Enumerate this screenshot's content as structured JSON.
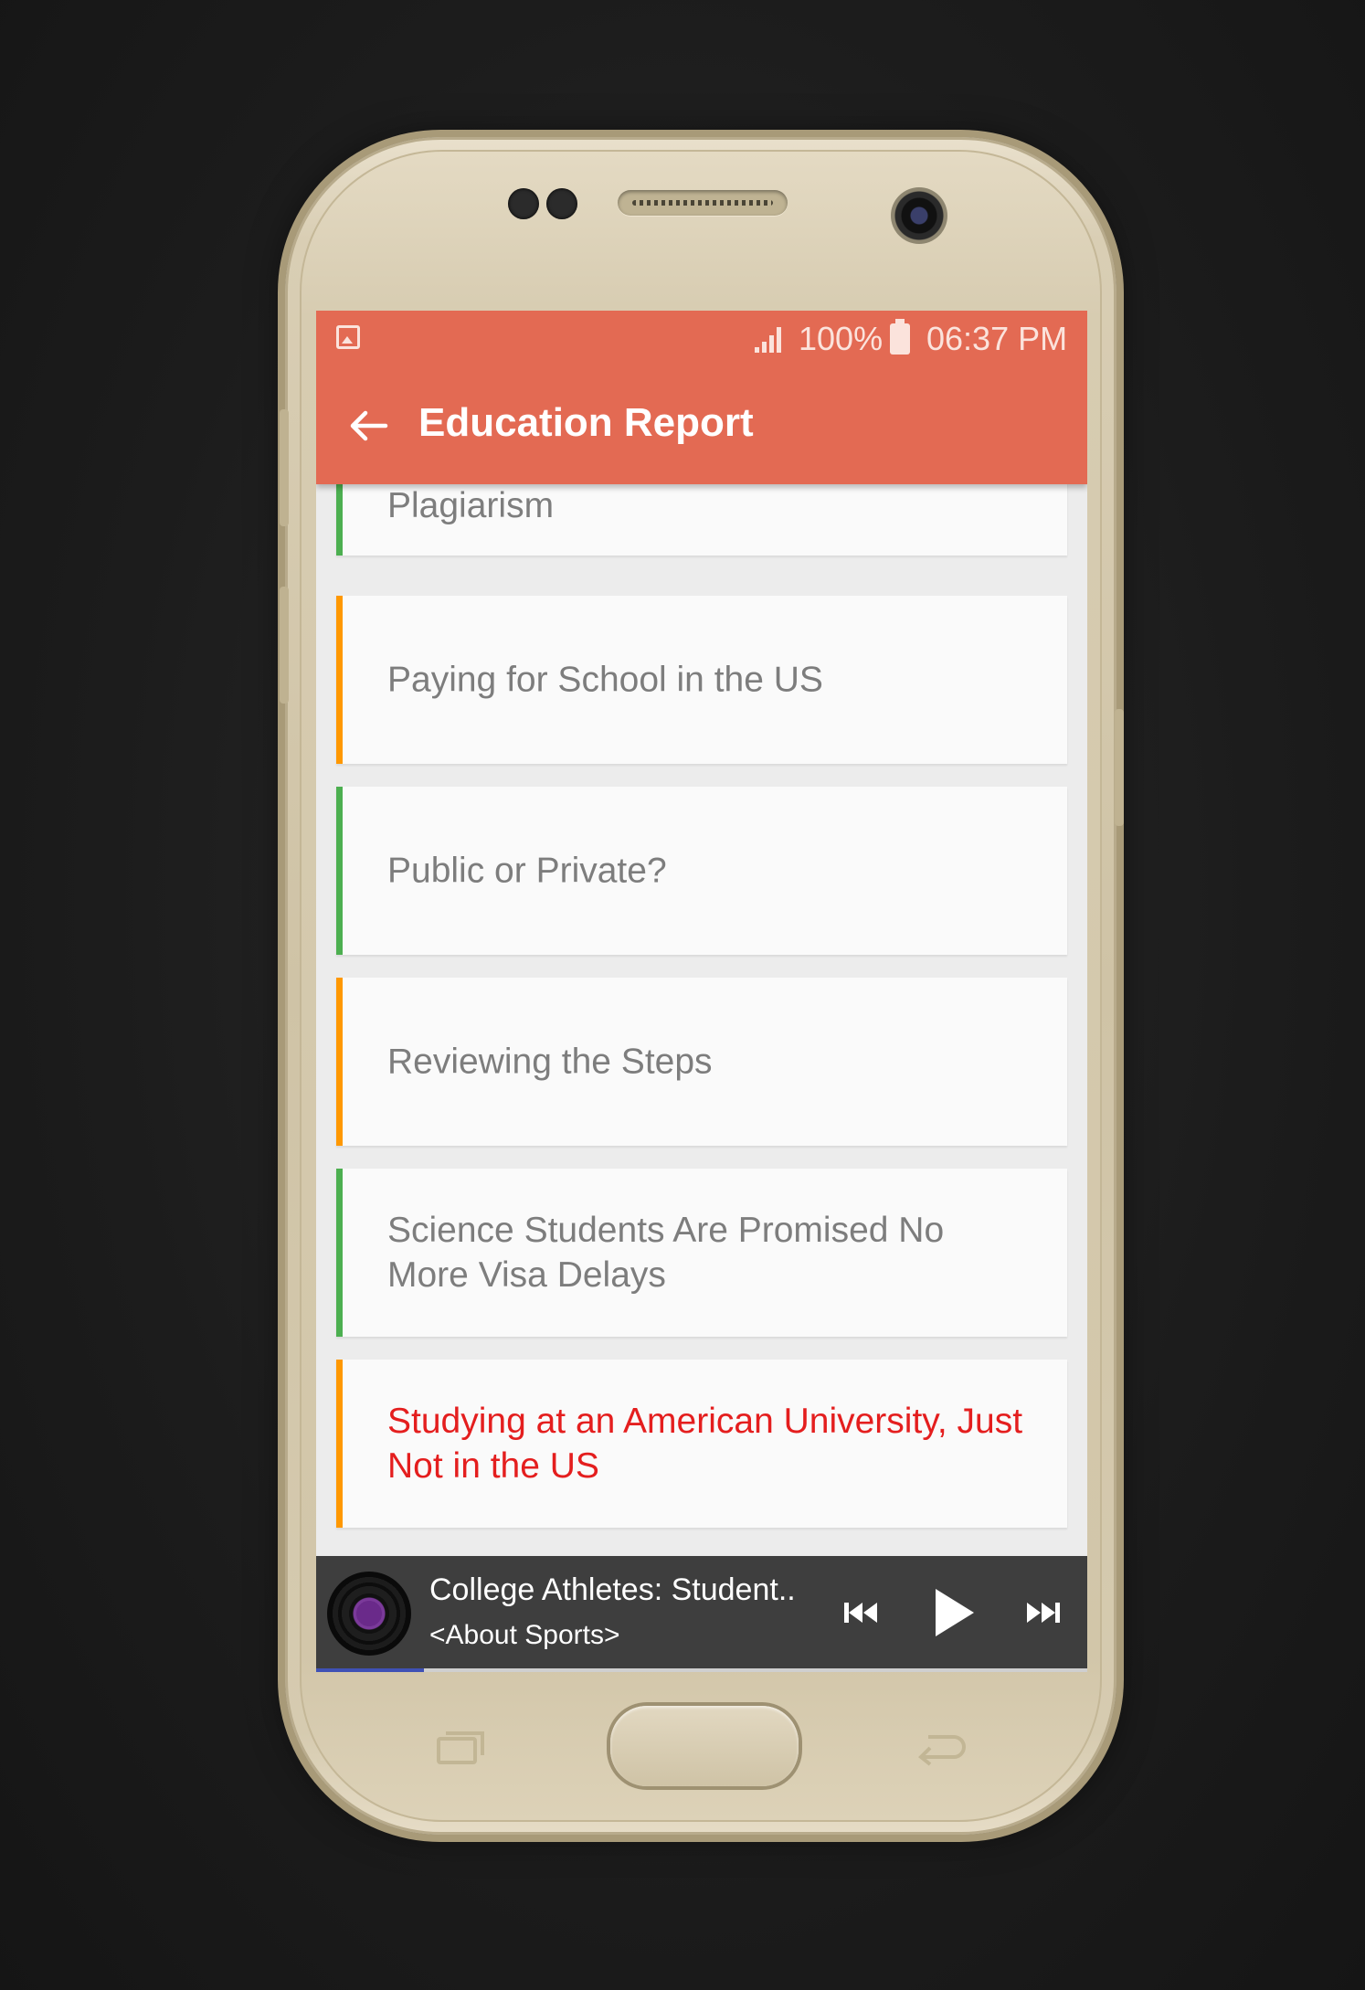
{
  "status_bar": {
    "battery_percent": "100%",
    "time": "06:37 PM"
  },
  "toolbar": {
    "title": "Education Report"
  },
  "articles": [
    {
      "title": "Plagiarism",
      "accent": "#4caf50"
    },
    {
      "title": "Paying for School in the US",
      "accent": "#ff9800"
    },
    {
      "title": "Public or Private?",
      "accent": "#4caf50"
    },
    {
      "title": "Reviewing the Steps",
      "accent": "#ff9800"
    },
    {
      "title": "Science Students Are Promised No More Visa Delays",
      "accent": "#4caf50"
    },
    {
      "title": "Studying at an American University, Just Not in the US",
      "accent": "#ff9800",
      "selected": true
    }
  ],
  "player": {
    "track_title": "College Athletes: Student..",
    "album": "<About Sports>",
    "progress": 0.14,
    "icons": [
      "previous-icon",
      "play-icon",
      "next-icon"
    ]
  },
  "colors": {
    "app_bar": "#e36a53",
    "selected_text": "#e41e1e",
    "item_text": "#7d7d7d",
    "player_bg": "#3e3e3e"
  }
}
